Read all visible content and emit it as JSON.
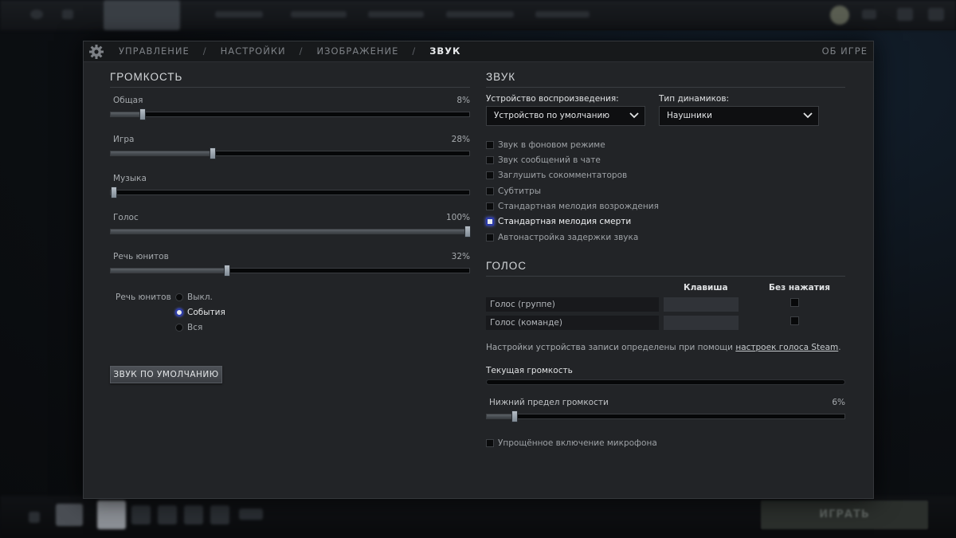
{
  "nav": {
    "crumbs": [
      "УПРАВЛЕНИЕ",
      "НАСТРОЙКИ",
      "ИЗОБРАЖЕНИЕ",
      "ЗВУК"
    ],
    "separator": "/",
    "about": "ОБ ИГРЕ"
  },
  "volume": {
    "title": "ГРОМКОСТЬ",
    "sliders": [
      {
        "label": "Общая",
        "value": 8,
        "display": "8%"
      },
      {
        "label": "Игра",
        "value": 28,
        "display": "28%"
      },
      {
        "label": "Музыка",
        "value": 0,
        "display": ""
      },
      {
        "label": "Голос",
        "value": 100,
        "display": "100%"
      },
      {
        "label": "Речь юнитов",
        "value": 32,
        "display": "32%"
      }
    ],
    "unit_speech": {
      "label": "Речь юнитов",
      "options": [
        "Выкл.",
        "События",
        "Вся"
      ],
      "selected": 1
    },
    "default_button": "ЗВУК ПО УМОЛЧАНИЮ"
  },
  "sound": {
    "title": "ЗВУК",
    "device_label": "Устройство воспроизведения:",
    "device_value": "Устройство по умолчанию",
    "speaker_label": "Тип динамиков:",
    "speaker_value": "Наушники",
    "checkboxes": [
      {
        "label": "Звук в фоновом режиме",
        "checked": false
      },
      {
        "label": "Звук сообщений в чате",
        "checked": false
      },
      {
        "label": "Заглушить сокомментаторов",
        "checked": false
      },
      {
        "label": "Субтитры",
        "checked": false
      },
      {
        "label": "Стандартная мелодия возрождения",
        "checked": false
      },
      {
        "label": "Стандартная мелодия смерти",
        "checked": false,
        "focused": true
      },
      {
        "label": "Автонастройка задержки звука",
        "checked": false
      }
    ]
  },
  "voice": {
    "title": "ГОЛОС",
    "col_key": "Клавиша",
    "col_open": "Без нажатия",
    "rows": [
      {
        "label": "Голос (группе)",
        "open_mic": false
      },
      {
        "label": "Голос (команде)",
        "open_mic": false
      }
    ],
    "info_prefix": "Настройки устройства записи определены при помощи ",
    "info_link": "настроек голоса Steam",
    "info_suffix": ".",
    "current_volume_label": "Текущая громкость",
    "current_volume_level": 0,
    "threshold_label": "Нижний предел громкости",
    "threshold_value": 6,
    "threshold_display": "6%",
    "mic_checkbox": "Упрощённое включение микрофона"
  },
  "background": {
    "play_label": "ИГРАТЬ"
  },
  "colors": {
    "panel": "#222427",
    "accent_focus": "#2b3aa8"
  }
}
